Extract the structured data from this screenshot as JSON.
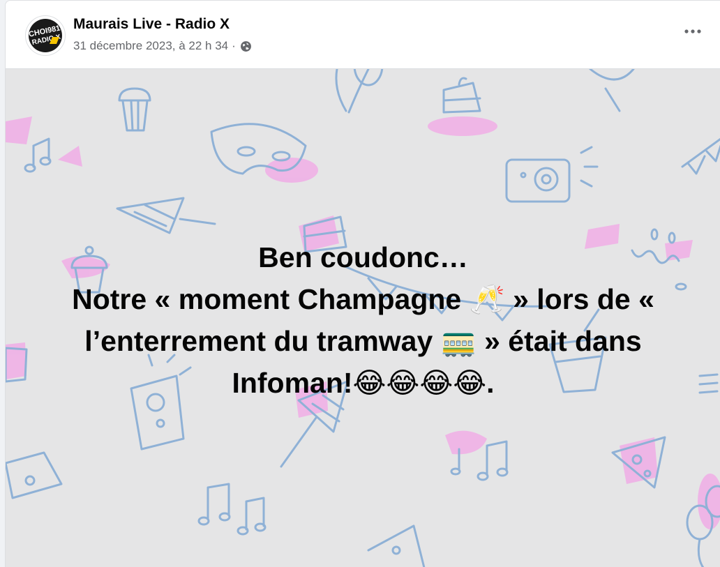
{
  "post": {
    "author": "Maurais Live - Radio X",
    "timestamp": "31 décembre 2023, à 22 h 34",
    "separator": "·",
    "privacy_icon": "globe-icon",
    "more_icon": "more-options-icon"
  },
  "avatar": {
    "logo_line1": "CHOI981",
    "logo_line2": "RADIO X"
  },
  "image_text": {
    "line1": "Ben coudonc…",
    "line2": "Notre « moment Champagne 🥂 » lors de «",
    "line3": "l’enterrement du tramway 🚃 » était dans",
    "line4": "Infoman!😂😂😂😂."
  },
  "colors": {
    "doodle_blue": "#8fb1d6",
    "doodle_pink": "#f2a5e6",
    "background": "#e5e5e6",
    "text_secondary": "#65676b"
  }
}
